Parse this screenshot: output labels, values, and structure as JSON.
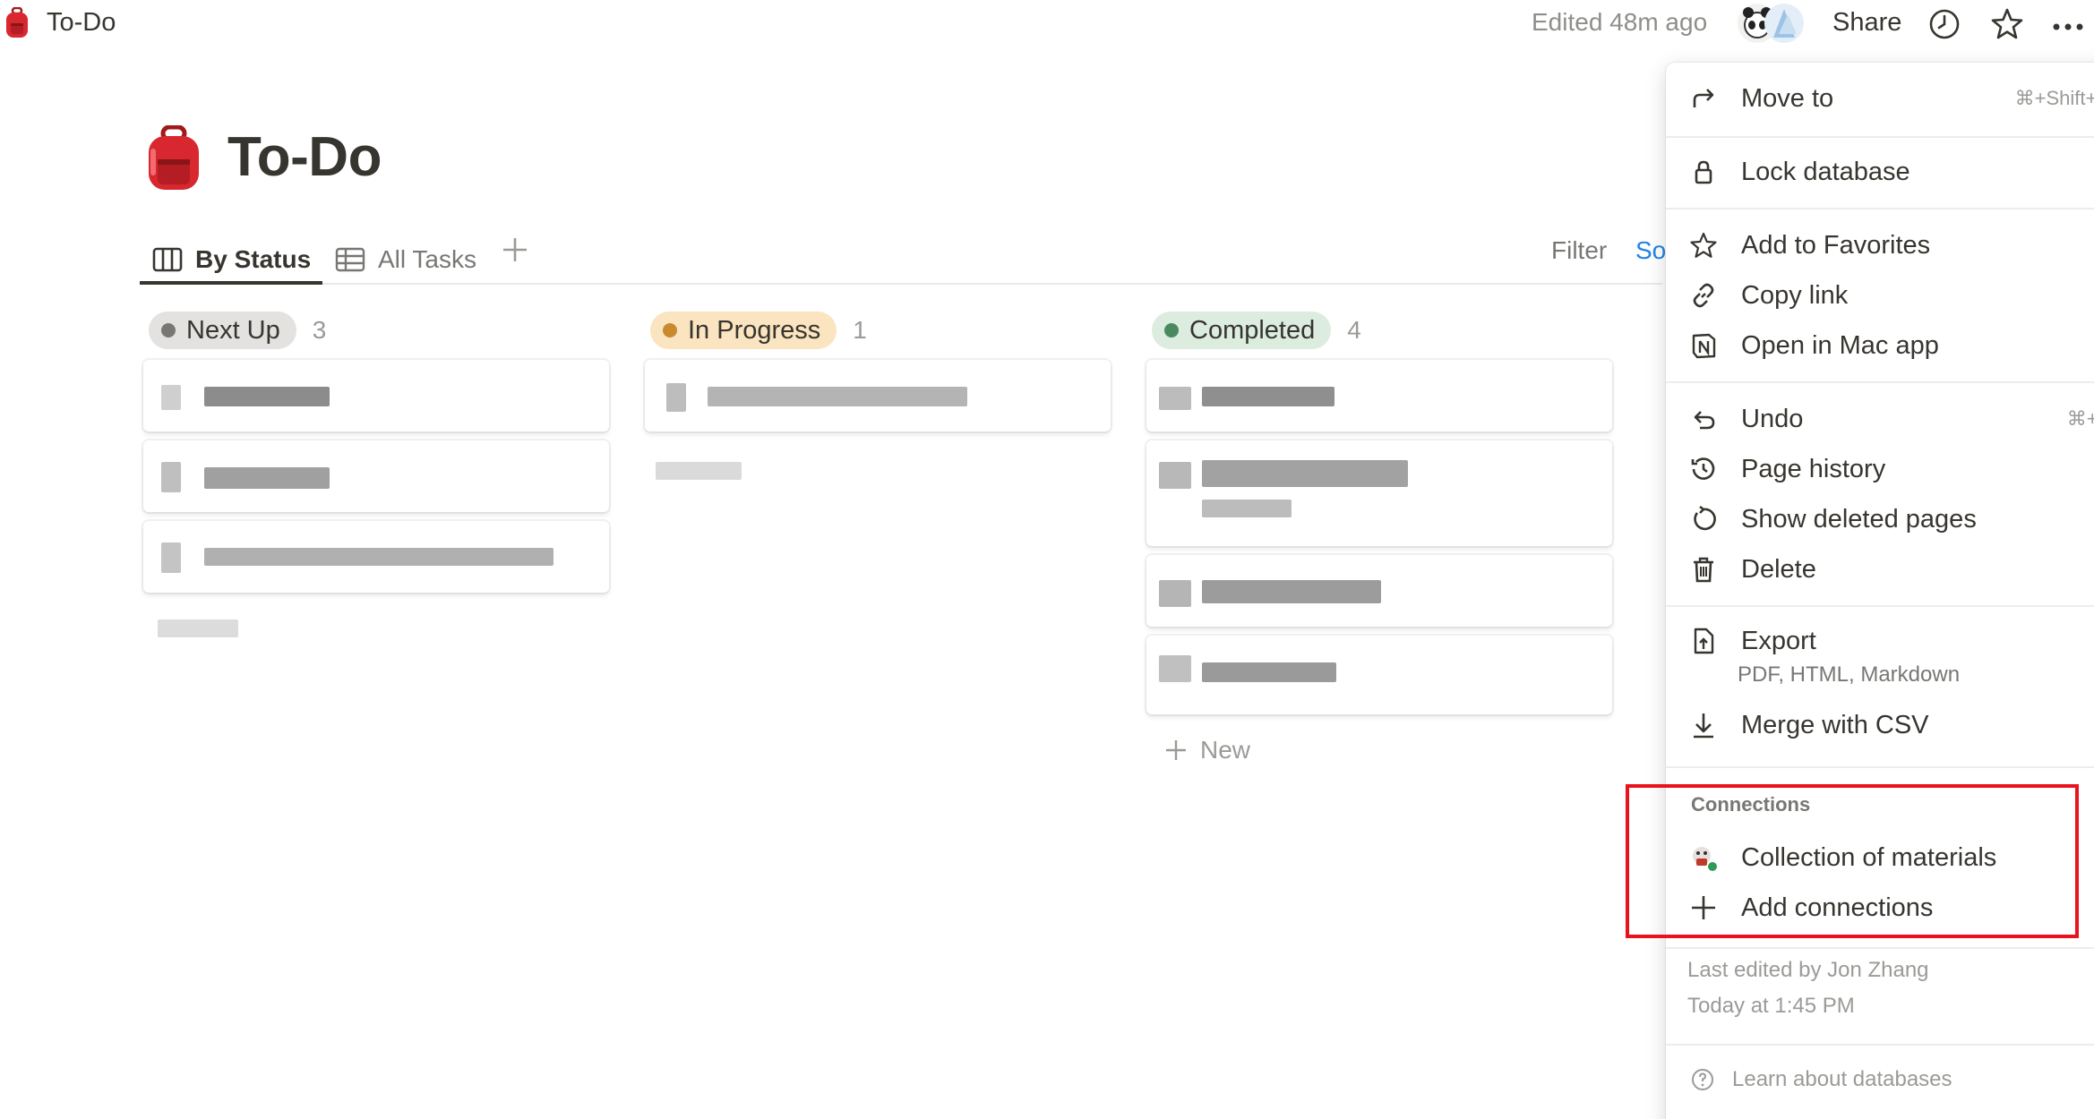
{
  "topbar": {
    "title": "To-Do",
    "edited": "Edited 48m ago",
    "share": "Share",
    "emoji_icon": "backpack-icon"
  },
  "page": {
    "title": "To-Do",
    "emoji_icon": "backpack-icon"
  },
  "views": {
    "tabs": [
      {
        "label": "By Status",
        "icon": "board-icon",
        "active": true
      },
      {
        "label": "All Tasks",
        "icon": "table-icon",
        "active": false
      }
    ],
    "filter": "Filter",
    "sort": "So"
  },
  "board": {
    "columns": [
      {
        "name": "Next Up",
        "count": "3",
        "color": "#787774",
        "bg": "#e3e2e0"
      },
      {
        "name": "In Progress",
        "count": "1",
        "color": "#c98a2e",
        "bg": "#fbe4c0"
      },
      {
        "name": "Completed",
        "count": "4",
        "color": "#4b8a5f",
        "bg": "#dcecdf"
      }
    ],
    "new_label": "New"
  },
  "menu": {
    "move_to": {
      "label": "Move to",
      "shortcut": "⌘+Shift+P"
    },
    "lock": "Lock database",
    "favorites": "Add to Favorites",
    "copy_link": "Copy link",
    "open_mac": "Open in Mac app",
    "undo": {
      "label": "Undo",
      "shortcut": "⌘+Z"
    },
    "history": "Page history",
    "deleted": "Show deleted pages",
    "delete": "Delete",
    "export": {
      "label": "Export",
      "sub": "PDF, HTML, Markdown"
    },
    "merge": "Merge with CSV",
    "connections": {
      "heading": "Connections",
      "items": [
        {
          "label": "Collection of materials",
          "icon": "integration-bot-icon"
        },
        {
          "label": "Add connections",
          "icon": "plus-icon"
        }
      ]
    },
    "last_edited": "Last edited by Jon Zhang",
    "last_edited_time": "Today at 1:45 PM",
    "learn": "Learn about databases"
  },
  "colors": {
    "highlight": "#e8131c",
    "link": "#2383e2"
  }
}
